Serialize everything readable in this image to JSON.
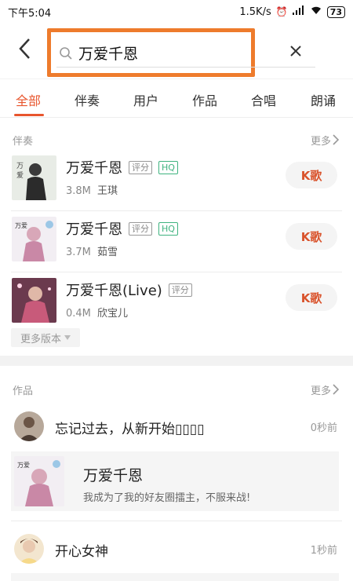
{
  "status_bar": {
    "time": "下午5:04",
    "net_speed": "1.5K/s",
    "battery": "73"
  },
  "search": {
    "value": "万爱千恩"
  },
  "tabs": [
    {
      "label": "全部",
      "active": true
    },
    {
      "label": "伴奏",
      "active": false
    },
    {
      "label": "用户",
      "active": false
    },
    {
      "label": "作品",
      "active": false
    },
    {
      "label": "合唱",
      "active": false
    },
    {
      "label": "朗诵",
      "active": false
    }
  ],
  "accompaniment": {
    "header": "伴奏",
    "more": "更多",
    "items": [
      {
        "title": "万爱千恩",
        "tags": [
          "评分",
          "HQ"
        ],
        "size": "3.8M",
        "artist": "王琪",
        "action": "K歌"
      },
      {
        "title": "万爱千恩",
        "tags": [
          "评分",
          "HQ"
        ],
        "size": "3.7M",
        "artist": "茹雪",
        "action": "K歌"
      },
      {
        "title": "万爱千恩(Live)",
        "tags": [
          "评分"
        ],
        "size": "0.4M",
        "artist": "欣宝儿",
        "action": "K歌"
      }
    ],
    "more_versions": "更多版本"
  },
  "works": {
    "header": "作品",
    "more": "更多",
    "items": [
      {
        "title": "忘记过去，从新开始▯▯▯▯",
        "time": "0秒前"
      },
      {
        "title": "开心女神",
        "time": "1秒前"
      }
    ],
    "card": {
      "title": "万爱千恩",
      "subtitle": "我成为了我的好友圈擂主，不服来战!"
    }
  },
  "colors": {
    "accent": "#e8552d",
    "highlight_box": "#ee7b2c",
    "hq_green": "#3fb37f"
  }
}
